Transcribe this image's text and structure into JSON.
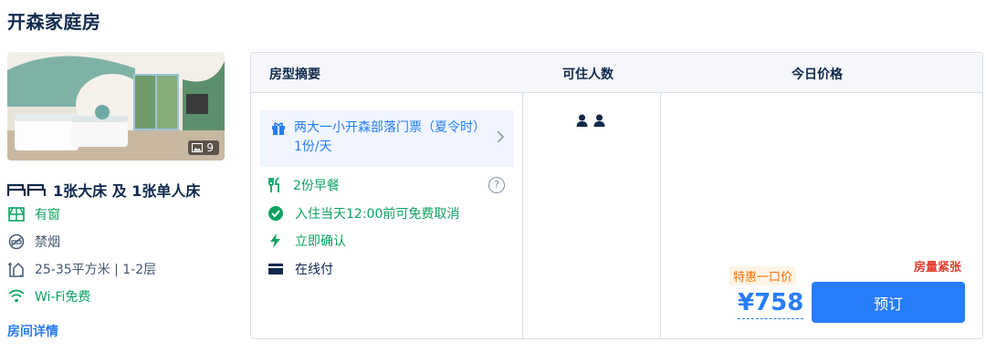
{
  "room": {
    "title": "开森家庭房",
    "photo_count": "9",
    "bed": "1张大床 及 1张单人床",
    "attributes": [
      {
        "label": "有窗",
        "icon": "window-icon"
      },
      {
        "label": "禁烟",
        "icon": "no-smoking-icon"
      },
      {
        "label": "25-35平方米 | 1-2层",
        "icon": "area-icon"
      },
      {
        "label": "Wi-Fi免费",
        "icon": "wifi-icon"
      }
    ],
    "detail_link": "房间详情"
  },
  "table": {
    "headers": {
      "summary": "房型摘要",
      "occupancy": "可住人数",
      "price": "今日价格"
    }
  },
  "offer": {
    "package": "两大一小开森部落门票（夏令时） 1份/天",
    "breakfast": "2份早餐",
    "help_icon_text": "?",
    "cancel": "入住当天12:00前可免费取消",
    "confirm": "立即确认",
    "payment": "在线付",
    "stock_warning": "房量紧张",
    "promo_label": "特惠一口价",
    "price": "¥758",
    "book_button": "预订"
  },
  "colors": {
    "accent": "#287dfa",
    "green": "#0ba361",
    "warning": "#e63b2e",
    "promo": "#ff6f00"
  }
}
